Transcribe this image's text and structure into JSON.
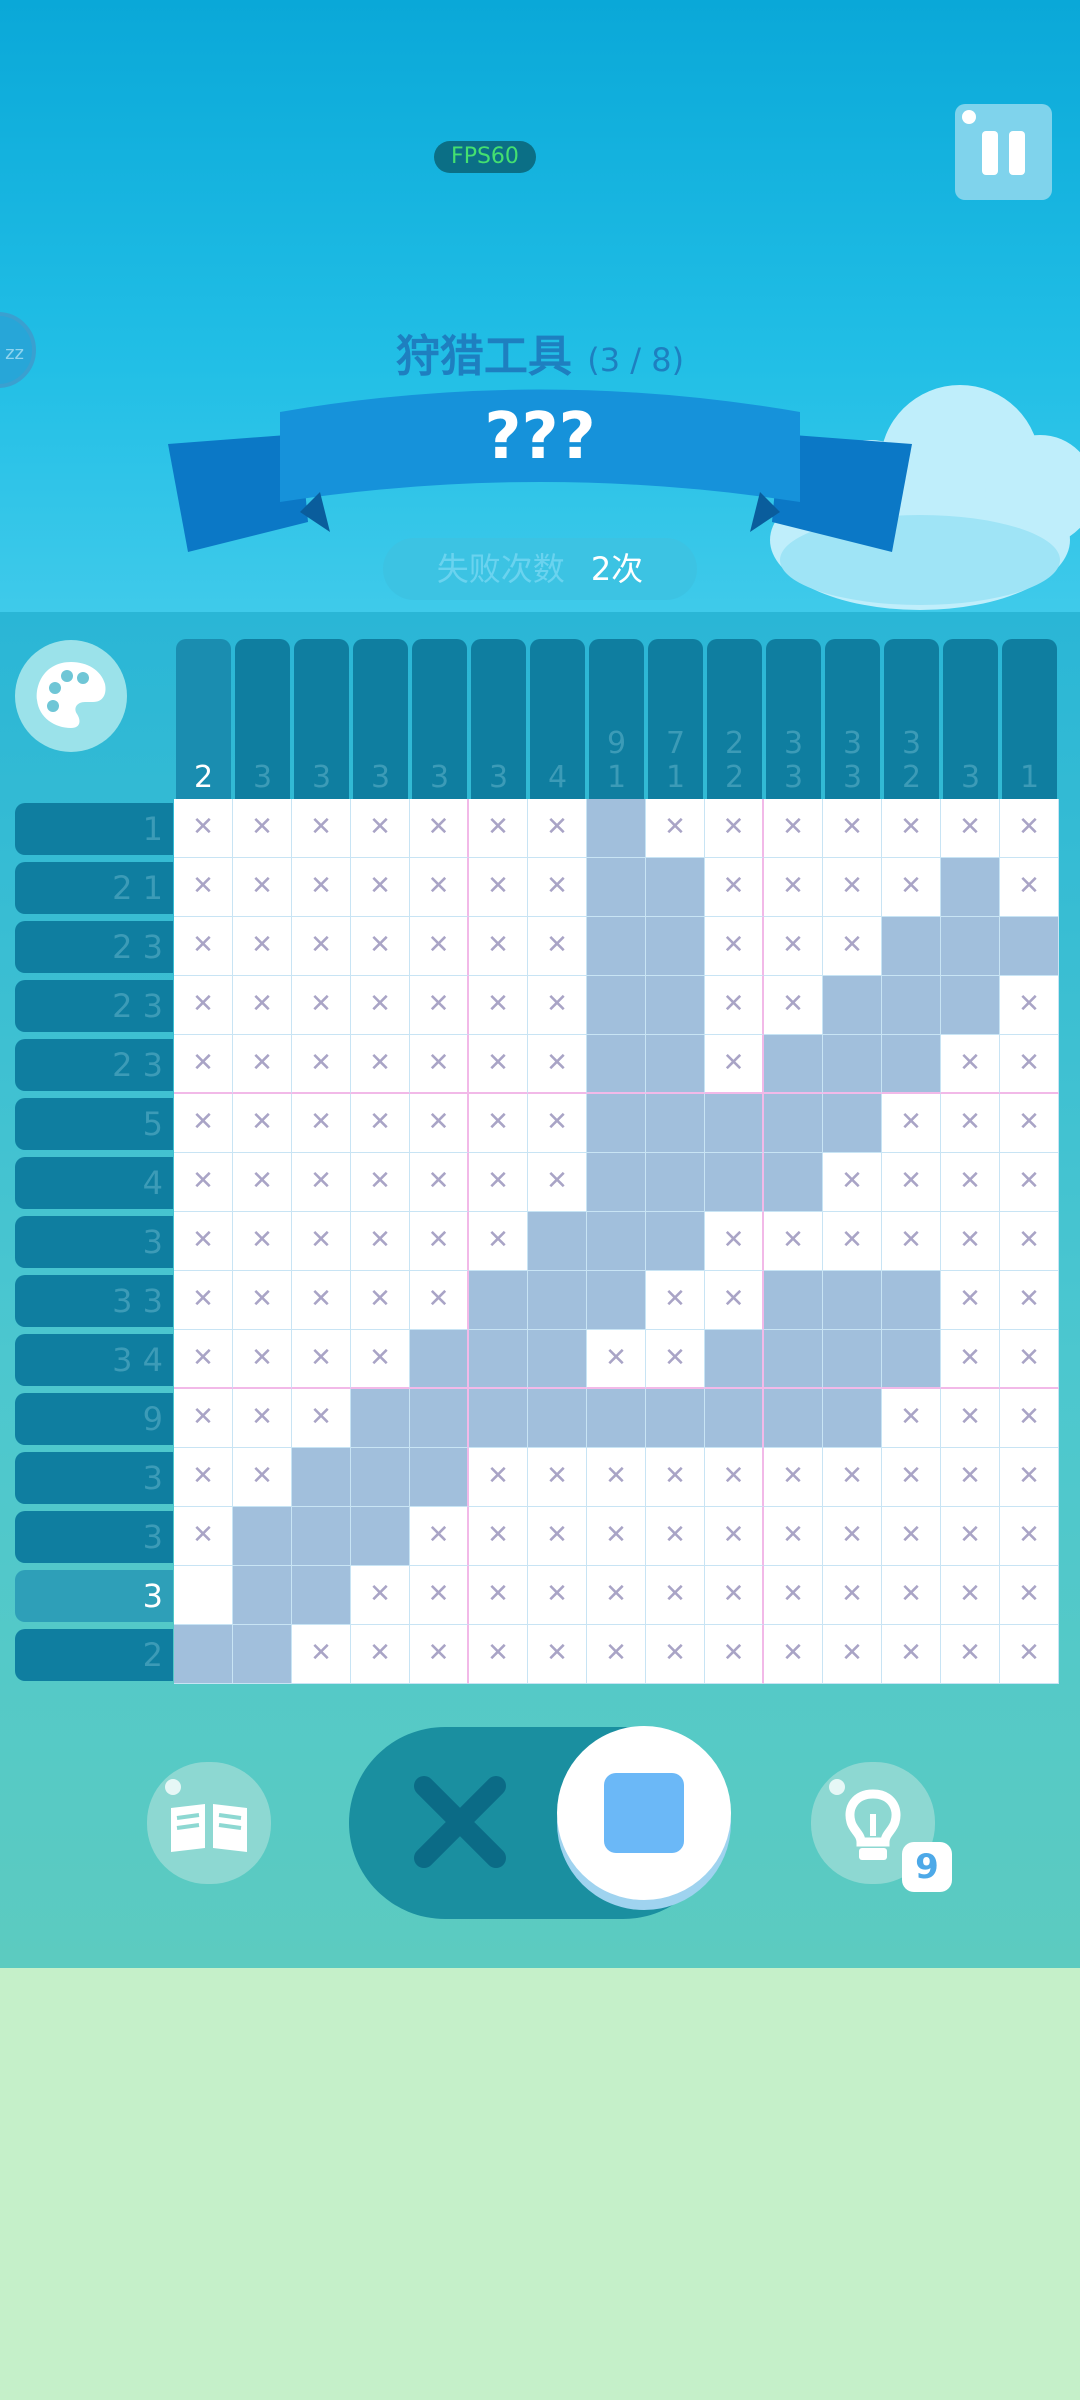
{
  "hud": {
    "fps_label": "FPS60",
    "zz_label": "zz"
  },
  "level": {
    "category": "狩猎工具",
    "progress": "(3 / 8)",
    "name": "???"
  },
  "failures": {
    "label": "失败次数",
    "value": "2次"
  },
  "colors": {
    "filled": "#a1bfdc",
    "clue_bg": "#0f7ea0",
    "cross": "#a9a4c6",
    "accent": "#6bb8f7"
  },
  "puzzle": {
    "col_clues": [
      [
        "2"
      ],
      [
        "3"
      ],
      [
        "3"
      ],
      [
        "3"
      ],
      [
        "3"
      ],
      [
        "3"
      ],
      [
        "4"
      ],
      [
        "9",
        "1"
      ],
      [
        "7",
        "1"
      ],
      [
        "2",
        "2"
      ],
      [
        "3",
        "3"
      ],
      [
        "3",
        "3"
      ],
      [
        "3",
        "2"
      ],
      [
        "3"
      ],
      [
        "1"
      ]
    ],
    "selected_col": 0,
    "row_clues": [
      "1",
      "2 1",
      "2 3",
      "2 3",
      "2 3",
      "5",
      "4",
      "3",
      "3 3",
      "3 4",
      "9",
      "3",
      "3",
      "3",
      "2"
    ],
    "selected_row": 13,
    "rows": [
      "xxxxxxx#xxxxxxx",
      "xxxxxxx##xxxx#x",
      "xxxxxxx##xxx###",
      "xxxxxxx##xx###x",
      "xxxxxxx##x###xx",
      "xxxxxxx#####xxx",
      "xxxxxxx####xxxx",
      "xxxxxx###xxxxxx",
      "xxxxx###xx###xx",
      "xxxx###xx####xx",
      "xxx#########xxx",
      "xx###xxxxxxxxxx",
      "x###xxxxxxxxxxx",
      ".##xxxxxxxxxxxx",
      "##xxxxxxxxxxxxx"
    ]
  },
  "controls": {
    "hint_count": "9",
    "mode": "fill"
  }
}
